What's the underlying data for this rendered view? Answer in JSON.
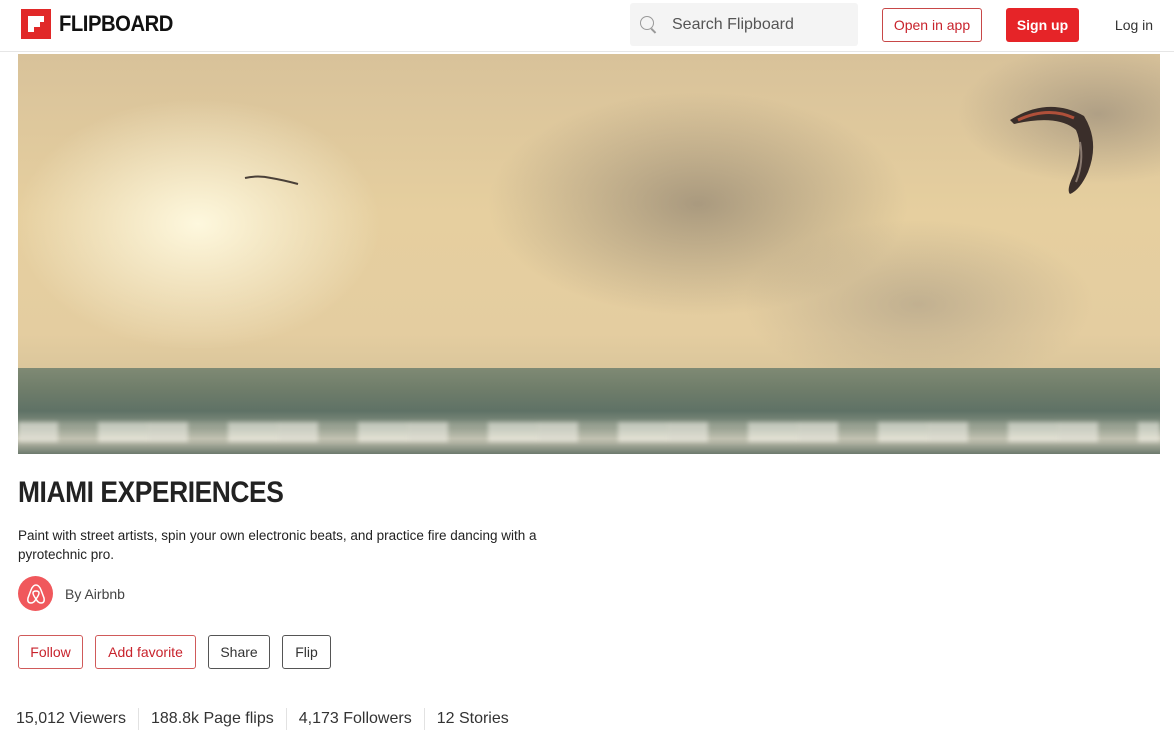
{
  "header": {
    "brand": "FLIPBOARD",
    "search_placeholder": "Search Flipboard",
    "open_in_app": "Open in app",
    "sign_up": "Sign up",
    "log_in": "Log in",
    "brand_color": "#e12828"
  },
  "hero": {
    "image_description": "Golden sunset sky with clouds over ocean waves, kite surfing kite in the sky"
  },
  "magazine": {
    "title": "MIAMI EXPERIENCES",
    "description": "Paint with street artists, spin your own electronic beats, and practice fire dancing with a pyrotechnic pro.",
    "author": "By Airbnb",
    "author_icon": "airbnb-logo-icon"
  },
  "actions": [
    {
      "label": "Follow",
      "style": "red"
    },
    {
      "label": "Add favorite",
      "style": "red"
    },
    {
      "label": "Share",
      "style": "grey"
    },
    {
      "label": "Flip",
      "style": "grey"
    }
  ],
  "stats": [
    "15,012 Viewers",
    "188.8k Page flips",
    "4,173 Followers",
    "12 Stories"
  ]
}
